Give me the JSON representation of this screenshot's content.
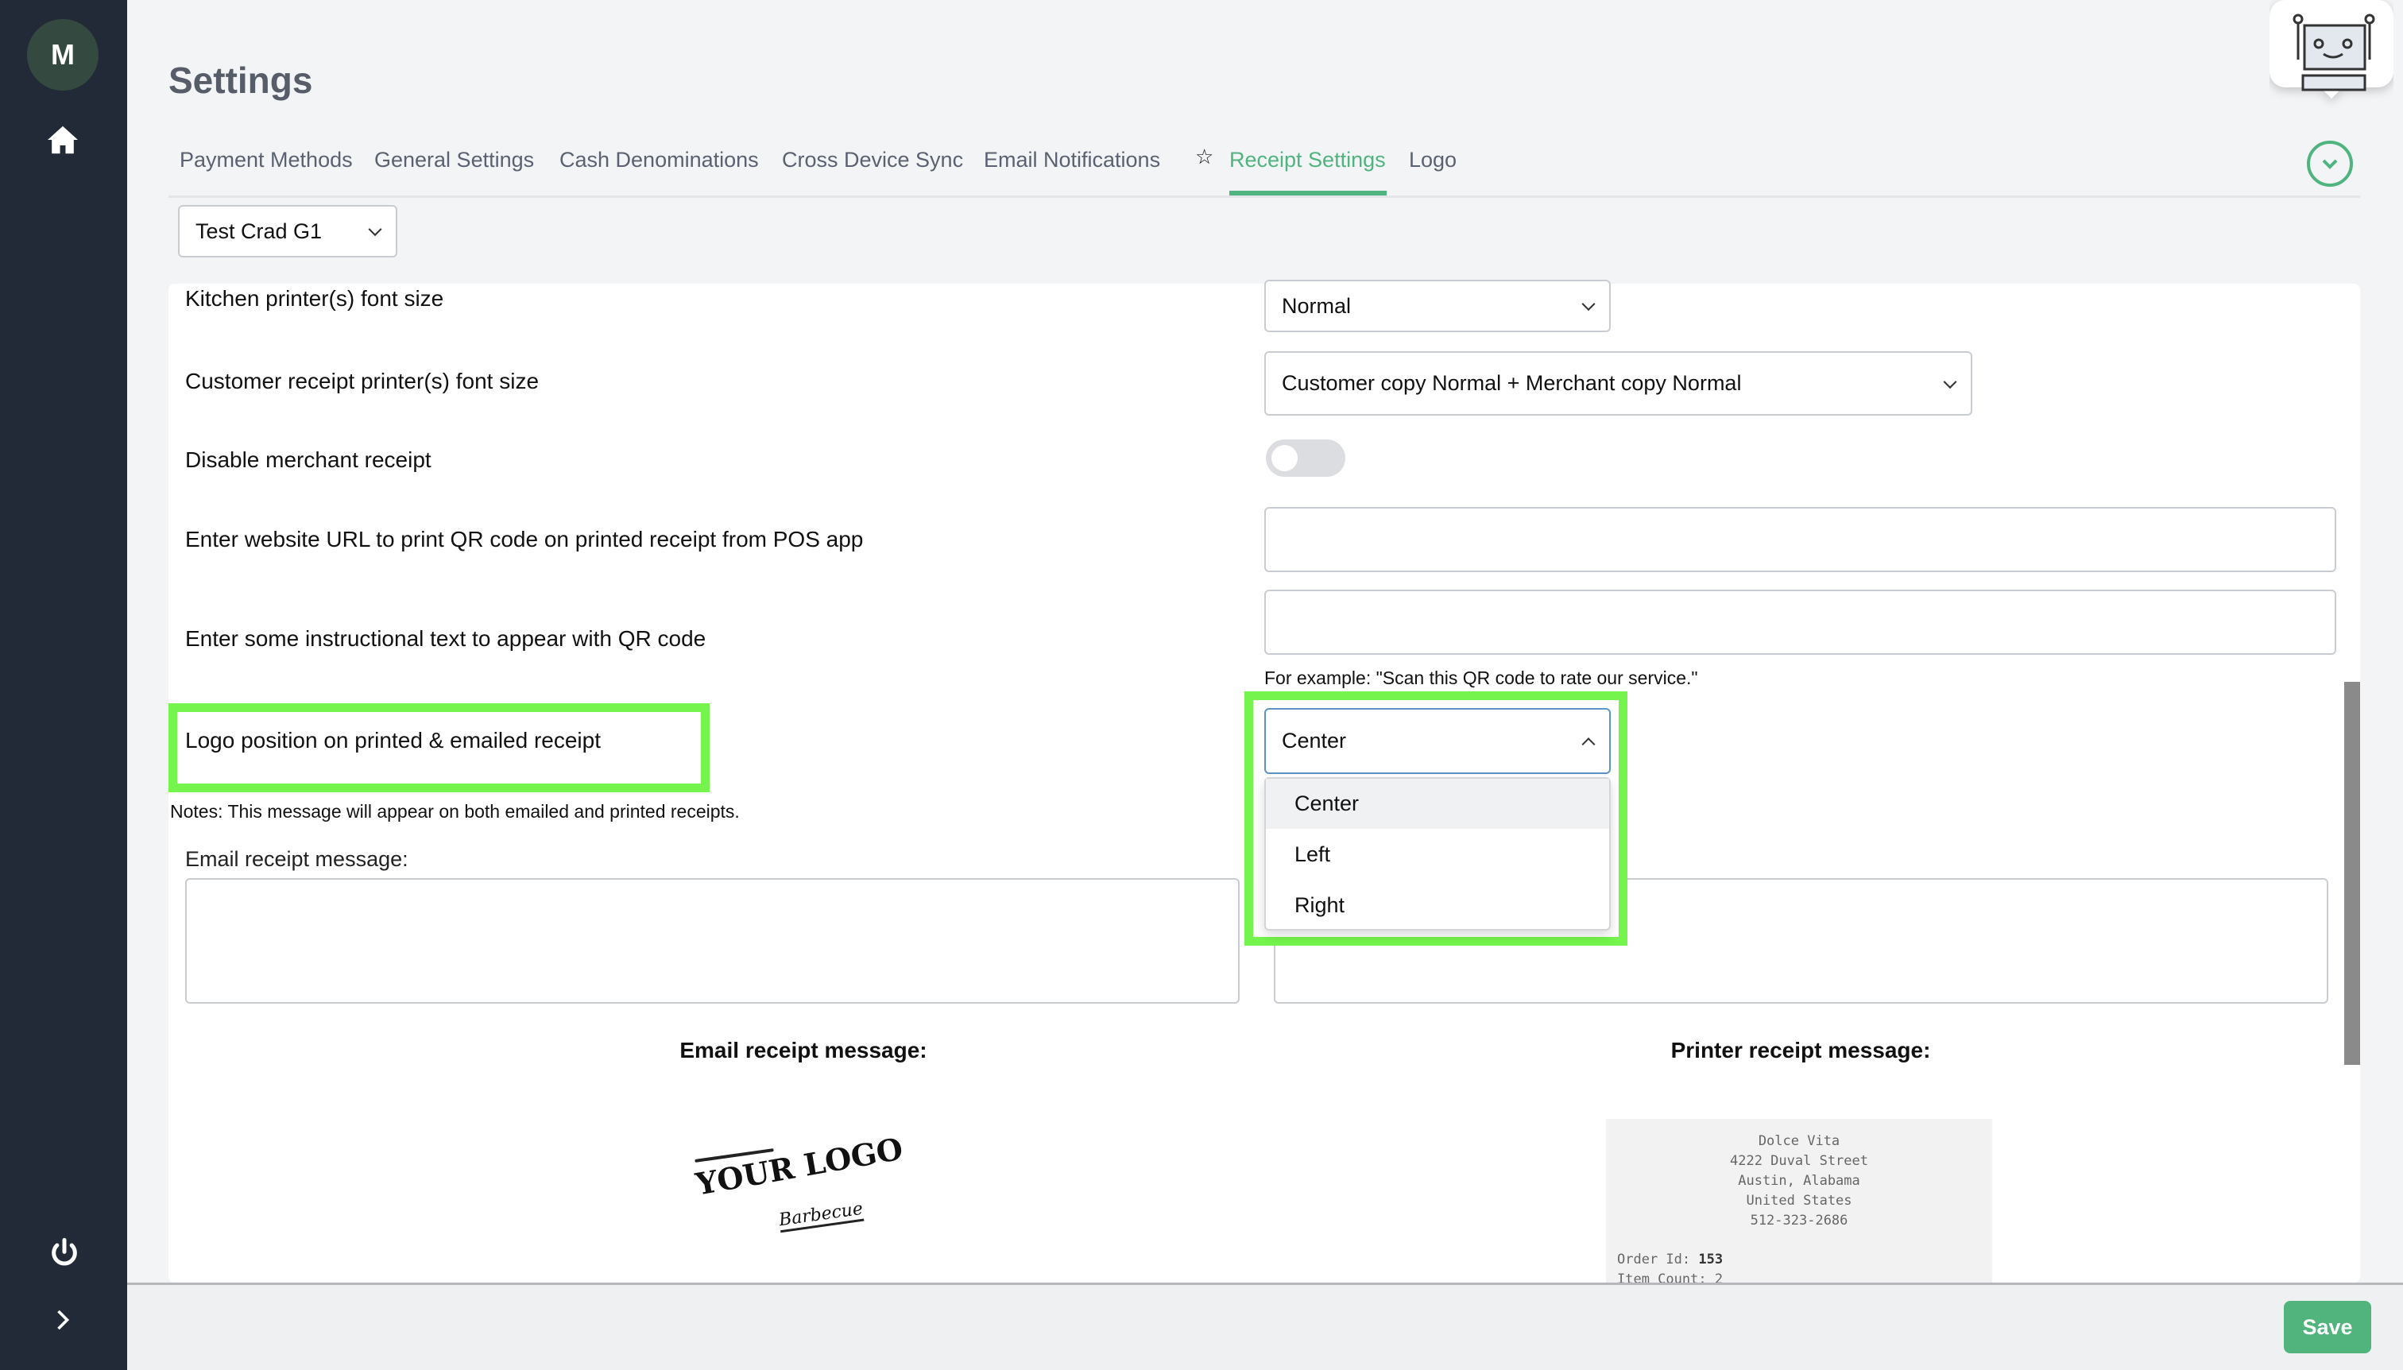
{
  "sidebar": {
    "avatar_initial": "M",
    "icons": [
      "home-icon",
      "power-icon",
      "chevron-right-icon"
    ]
  },
  "header": {
    "title": "Settings"
  },
  "tabs": [
    {
      "label": "Payment Methods"
    },
    {
      "label": "General Settings"
    },
    {
      "label": "Cash Denominations"
    },
    {
      "label": "Cross Device Sync"
    },
    {
      "label": "Email Notifications"
    },
    {
      "label": "Receipt Settings",
      "active": true,
      "icon": "star-icon"
    },
    {
      "label": "Logo"
    }
  ],
  "store_select": {
    "value": "Test Crad G1"
  },
  "settings": {
    "kitchen_font": {
      "label": "Kitchen printer(s) font size",
      "value": "Normal"
    },
    "customer_font": {
      "label": "Customer receipt printer(s) font size",
      "value": "Customer copy Normal + Merchant copy Normal"
    },
    "disable_merchant": {
      "label": "Disable merchant receipt",
      "enabled": false
    },
    "qr_url": {
      "label": "Enter website URL to print QR code on printed receipt from POS app",
      "value": ""
    },
    "qr_text": {
      "label": "Enter some instructional text to appear with QR code",
      "value": "",
      "hint": "For example: \"Scan this QR code to rate our service.\""
    },
    "logo_position": {
      "label": "Logo position on printed & emailed receipt",
      "value": "Center",
      "options": [
        "Center",
        "Left",
        "Right"
      ]
    },
    "notes": "Notes: This message will appear on both emailed and printed receipts.",
    "email_message_label": "Email receipt message:"
  },
  "preview": {
    "email_heading": "Email receipt message:",
    "printer_heading": "Printer receipt message:",
    "logo": {
      "text": "YOUR LOGO",
      "subtext": "Barbecue"
    },
    "receipt_lines": [
      "Dolce Vita",
      "4222 Duval Street",
      "Austin, Alabama",
      "United States",
      "512-323-2686"
    ],
    "order_id_label": "Order Id:",
    "order_id": "153",
    "item_count": "Item Count: 2"
  },
  "footer": {
    "save_label": "Save"
  },
  "colors": {
    "accent": "#4fb47f",
    "sidebar": "#222a38",
    "highlight": "#74f44c"
  }
}
